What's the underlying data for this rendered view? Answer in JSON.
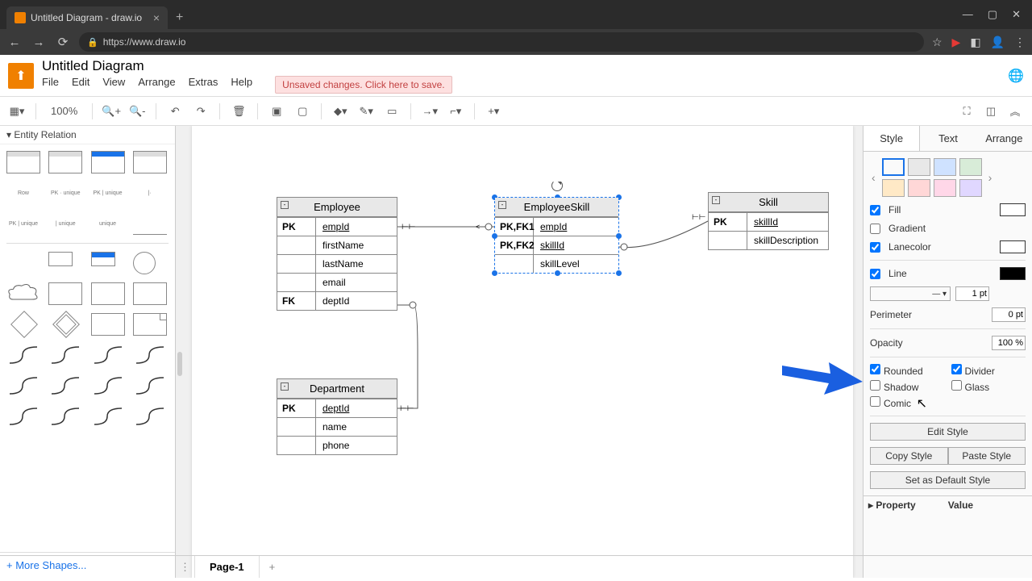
{
  "browser": {
    "tab_title": "Untitled Diagram - draw.io",
    "url": "https://www.draw.io"
  },
  "app": {
    "title": "Untitled Diagram",
    "menus": [
      "File",
      "Edit",
      "View",
      "Arrange",
      "Extras",
      "Help"
    ],
    "save_banner": "Unsaved changes. Click here to save."
  },
  "toolbar": {
    "zoom": "100%"
  },
  "sidebar": {
    "section": "Entity Relation",
    "row_label": "Row",
    "more_shapes": "+ More Shapes..."
  },
  "canvas": {
    "tables": {
      "employee": {
        "title": "Employee",
        "rows": [
          {
            "key": "PK",
            "attr": "empId",
            "u": true
          },
          {
            "key": "",
            "attr": "firstName"
          },
          {
            "key": "",
            "attr": "lastName"
          },
          {
            "key": "",
            "attr": "email"
          },
          {
            "key": "FK",
            "attr": "deptId"
          }
        ]
      },
      "employeeskill": {
        "title": "EmployeeSkill",
        "rows": [
          {
            "key": "PK,FK1",
            "attr": "empId",
            "u": true
          },
          {
            "key": "PK,FK2",
            "attr": "skillId",
            "u": true
          },
          {
            "key": "",
            "attr": "skillLevel"
          }
        ]
      },
      "skill": {
        "title": "Skill",
        "rows": [
          {
            "key": "PK",
            "attr": "skillId",
            "u": true
          },
          {
            "key": "",
            "attr": "skillDescription"
          }
        ]
      },
      "department": {
        "title": "Department",
        "rows": [
          {
            "key": "PK",
            "attr": "deptId",
            "u": true
          },
          {
            "key": "",
            "attr": "name"
          },
          {
            "key": "",
            "attr": "phone"
          }
        ]
      }
    }
  },
  "right_panel": {
    "tabs": [
      "Style",
      "Text",
      "Arrange"
    ],
    "swatches_top": [
      "#ffffff",
      "#e8e8e8",
      "#cfe2ff",
      "#d8ecd8"
    ],
    "swatches_bot": [
      "#ffe9c6",
      "#ffd7d7",
      "#ffd7e8",
      "#e0d7ff"
    ],
    "fill": {
      "label": "Fill",
      "checked": true,
      "color": "#ffffff"
    },
    "gradient": {
      "label": "Gradient",
      "checked": false
    },
    "lanecolor": {
      "label": "Lanecolor",
      "checked": true,
      "color": "#ffffff"
    },
    "line": {
      "label": "Line",
      "checked": true,
      "color": "#000000",
      "width": "1 pt"
    },
    "perimeter": {
      "label": "Perimeter",
      "value": "0 pt"
    },
    "opacity": {
      "label": "Opacity",
      "value": "100 %"
    },
    "checks": {
      "rounded": {
        "label": "Rounded",
        "checked": true
      },
      "divider": {
        "label": "Divider",
        "checked": true
      },
      "shadow": {
        "label": "Shadow",
        "checked": false
      },
      "glass": {
        "label": "Glass",
        "checked": false
      },
      "comic": {
        "label": "Comic",
        "checked": false
      }
    },
    "buttons": {
      "edit": "Edit Style",
      "copy": "Copy Style",
      "paste": "Paste Style",
      "default": "Set as Default Style"
    },
    "prop_header": {
      "property": "Property",
      "value": "Value"
    }
  },
  "footer": {
    "page": "Page-1"
  }
}
